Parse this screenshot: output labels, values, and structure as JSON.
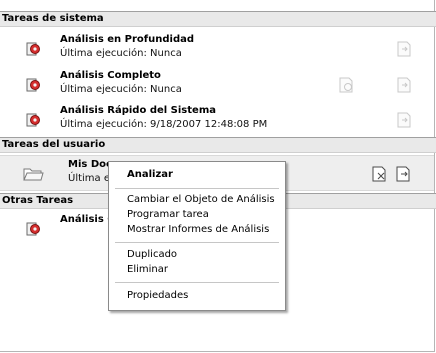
{
  "sections": {
    "system": {
      "title": "Tareas de sistema"
    },
    "user": {
      "title": "Tareas del usuario"
    },
    "other": {
      "title": "Otras Tareas"
    }
  },
  "tasks": {
    "deep": {
      "name": "Análisis en Profundidad",
      "status": "Última ejecución: Nunca",
      "icon": "scan-drive-icon"
    },
    "full": {
      "name": "Análisis Completo",
      "status": "Última ejecución: Nunca",
      "icon": "scan-drive-icon"
    },
    "quick": {
      "name": "Análisis Rápido del Sistema",
      "status": "Última ejecución: 9/18/2007 12:48:08 PM",
      "icon": "scan-drive-icon"
    },
    "mydocs": {
      "name": "Mis Doc",
      "status": "Última eje",
      "icon": "folder-icon"
    },
    "other1": {
      "name": "Análisis C",
      "icon": "scan-drive-icon"
    }
  },
  "context_menu": {
    "analyze": "Analizar",
    "change_object": "Cambiar el Objeto de Análisis",
    "schedule": "Programar tarea",
    "show_reports": "Mostrar Informes de Análisis",
    "duplicate": "Duplicado",
    "delete": "Eliminar",
    "properties": "Propiedades"
  }
}
